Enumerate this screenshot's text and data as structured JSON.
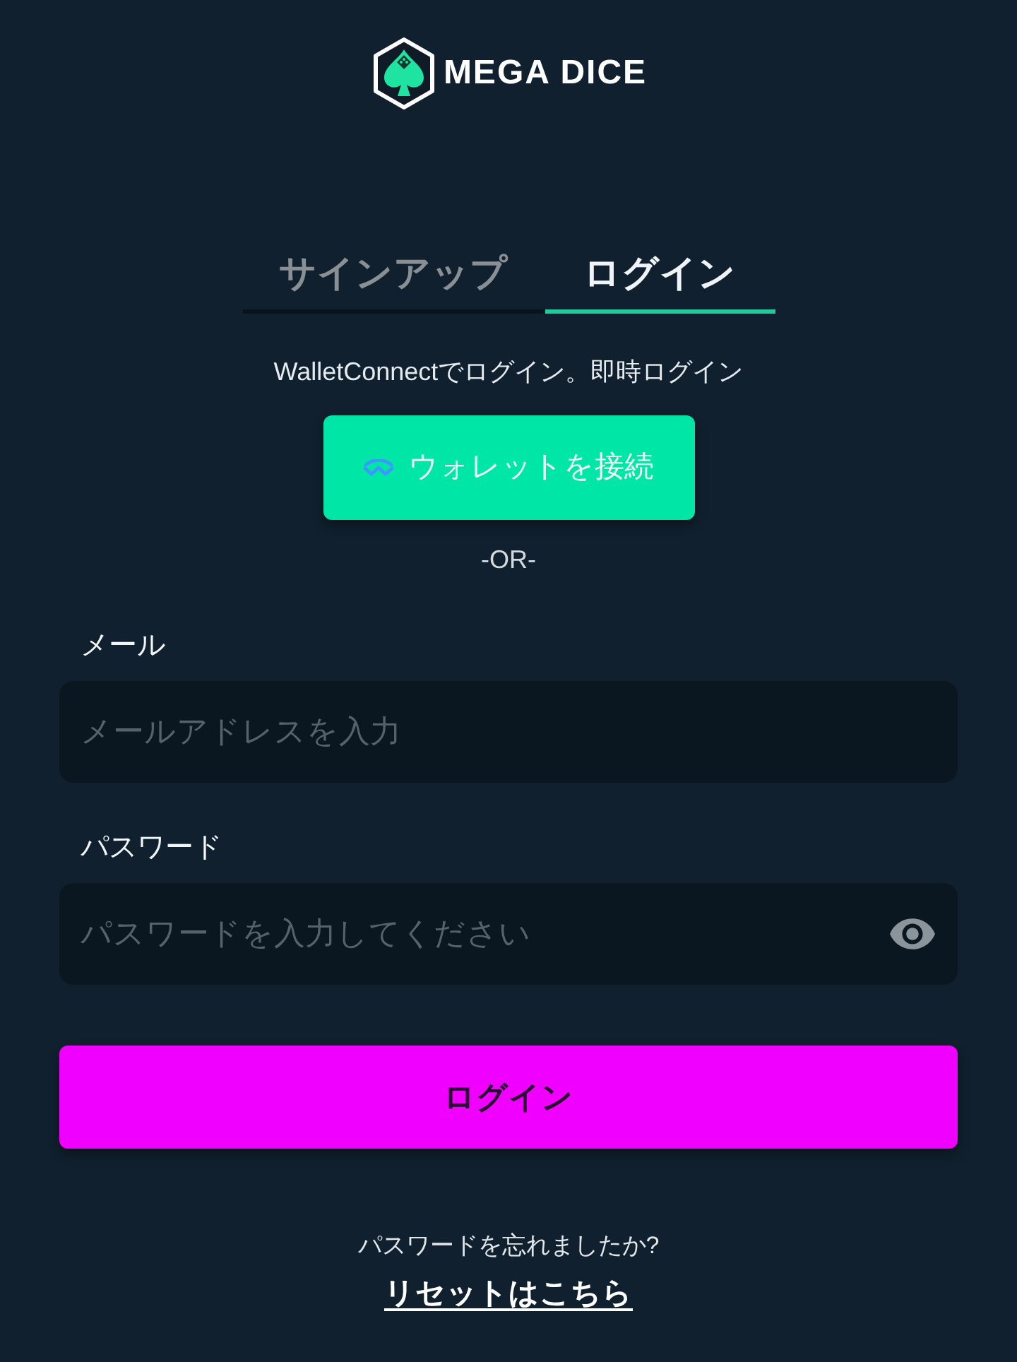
{
  "logo": {
    "text": "MEGA DICE"
  },
  "tabs": [
    {
      "label": "サインアップ",
      "selected": false
    },
    {
      "label": "ログイン",
      "selected": true
    }
  ],
  "wallet": {
    "prompt": "WalletConnectでログイン。即時ログイン",
    "button": "ウォレットを接続",
    "divider": "-OR-"
  },
  "form": {
    "fields": [
      {
        "label": "メール",
        "placeholder": "メールアドレスを入力",
        "kind": "email"
      },
      {
        "label": "パスワード",
        "placeholder": "パスワードを入力してください",
        "kind": "password"
      }
    ],
    "submit": "ログイン"
  },
  "footer": {
    "question": "パスワードを忘れましたか?",
    "link": "リセットはこちら"
  }
}
